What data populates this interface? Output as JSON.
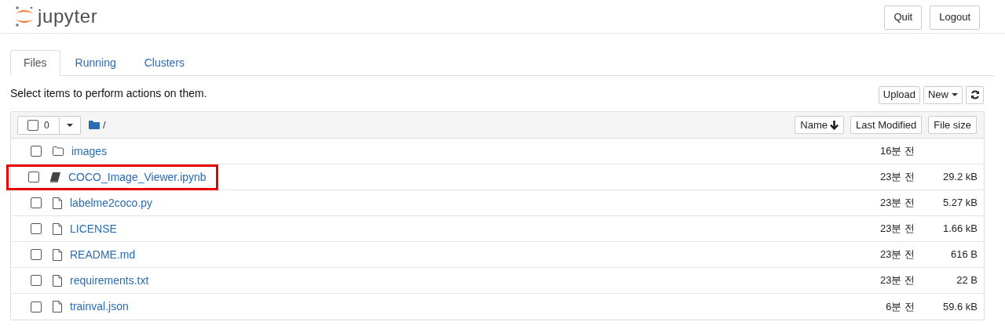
{
  "header": {
    "logo_text": "jupyter",
    "buttons": [
      "Quit",
      "Logout"
    ]
  },
  "tabs": [
    {
      "label": "Files",
      "selected": true
    },
    {
      "label": "Running",
      "selected": false
    },
    {
      "label": "Clusters",
      "selected": false
    }
  ],
  "instructions": "Select items to perform actions on them.",
  "toolbar": {
    "upload": "Upload",
    "new": "New"
  },
  "list_header": {
    "selected_count": "0",
    "path": "/",
    "sort_buttons": [
      "Name",
      "Last Modified",
      "File size"
    ]
  },
  "items": [
    {
      "kind": "folder",
      "name": "images",
      "modified": "16분 전",
      "highlighted": false,
      "checked": false
    },
    {
      "kind": "notebook",
      "name": "COCO_Image_Viewer.ipynb",
      "modified": "23분 전",
      "size": "29.2 kB",
      "highlighted": true,
      "checked": false
    },
    {
      "kind": "file",
      "name": "labelme2coco.py",
      "modified": "23분 전",
      "size": "5.27 kB",
      "highlighted": false,
      "checked": false
    },
    {
      "kind": "file",
      "name": "LICENSE",
      "modified": "23분 전",
      "size": "1.66 kB",
      "highlighted": false,
      "checked": false
    },
    {
      "kind": "file",
      "name": "README.md",
      "modified": "23분 전",
      "size": "616 B",
      "highlighted": false,
      "checked": false
    },
    {
      "kind": "file",
      "name": "requirements.txt",
      "modified": "23분 전",
      "size": "22 B",
      "highlighted": false,
      "checked": false
    },
    {
      "kind": "file",
      "name": "trainval.json",
      "modified": "6분 전",
      "size": "59.6 kB",
      "highlighted": false,
      "checked": false
    }
  ]
}
